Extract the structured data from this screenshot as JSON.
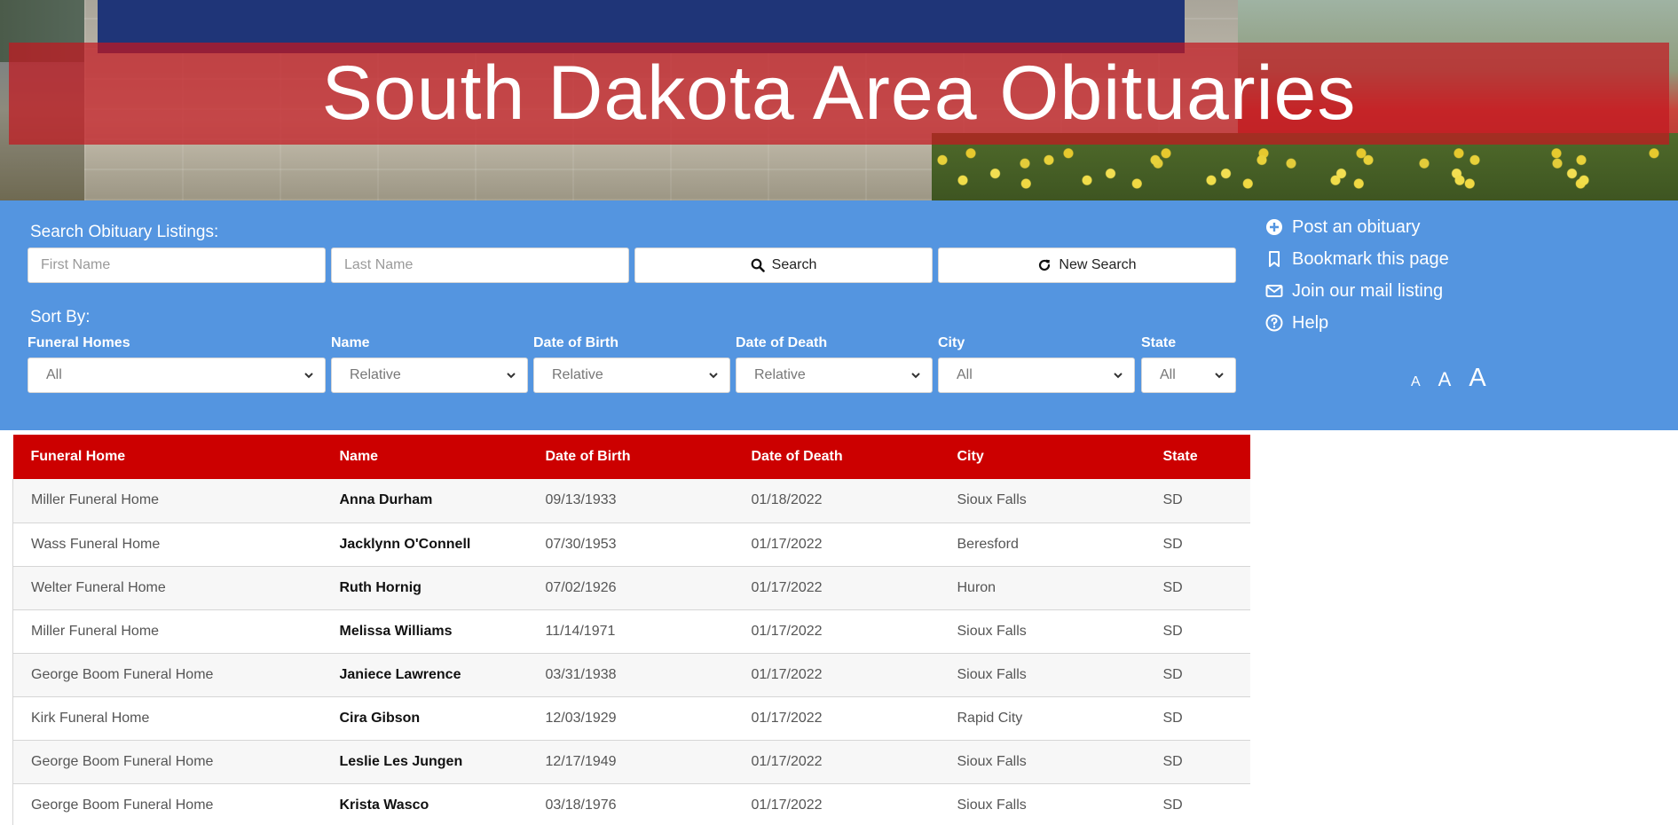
{
  "header": {
    "title": "South Dakota Area Obituaries"
  },
  "search": {
    "heading": "Search Obituary Listings:",
    "first_name_placeholder": "First Name",
    "last_name_placeholder": "Last Name",
    "search_label": "Search",
    "new_search_label": "New Search"
  },
  "sort": {
    "heading": "Sort By:",
    "filters": [
      {
        "label": "Funeral Homes",
        "value": "All"
      },
      {
        "label": "Name",
        "value": "Relative"
      },
      {
        "label": "Date of Birth",
        "value": "Relative"
      },
      {
        "label": "Date of Death",
        "value": "Relative"
      },
      {
        "label": "City",
        "value": "All"
      },
      {
        "label": "State",
        "value": "All"
      }
    ]
  },
  "side_links": [
    {
      "label": "Post an obituary",
      "icon": "plus-circle-icon"
    },
    {
      "label": "Bookmark this page",
      "icon": "bookmark-icon"
    },
    {
      "label": "Join our mail listing",
      "icon": "envelope-icon"
    },
    {
      "label": "Help",
      "icon": "question-circle-icon"
    }
  ],
  "font_sizer": {
    "small": "A",
    "medium": "A",
    "large": "A"
  },
  "table": {
    "columns": [
      "Funeral Home",
      "Name",
      "Date of Birth",
      "Date of Death",
      "City",
      "State"
    ],
    "rows": [
      [
        "Miller Funeral Home",
        "Anna Durham",
        "09/13/1933",
        "01/18/2022",
        "Sioux Falls",
        "SD"
      ],
      [
        "Wass Funeral Home",
        "Jacklynn O'Connell",
        "07/30/1953",
        "01/17/2022",
        "Beresford",
        "SD"
      ],
      [
        "Welter Funeral Home",
        "Ruth Hornig",
        "07/02/1926",
        "01/17/2022",
        "Huron",
        "SD"
      ],
      [
        "Miller Funeral Home",
        "Melissa Williams",
        "11/14/1971",
        "01/17/2022",
        "Sioux Falls",
        "SD"
      ],
      [
        "George Boom Funeral Home",
        "Janiece Lawrence",
        "03/31/1938",
        "01/17/2022",
        "Sioux Falls",
        "SD"
      ],
      [
        "Kirk Funeral Home",
        "Cira Gibson",
        "12/03/1929",
        "01/17/2022",
        "Rapid City",
        "SD"
      ],
      [
        "George Boom Funeral Home",
        "Leslie Les Jungen",
        "12/17/1949",
        "01/17/2022",
        "Sioux Falls",
        "SD"
      ],
      [
        "George Boom Funeral Home",
        "Krista Wasco",
        "03/18/1976",
        "01/17/2022",
        "Sioux Falls",
        "SD"
      ]
    ]
  },
  "colors": {
    "panel_blue": "#5495e0",
    "header_red": "#cc0000",
    "title_band": "#c41820"
  }
}
